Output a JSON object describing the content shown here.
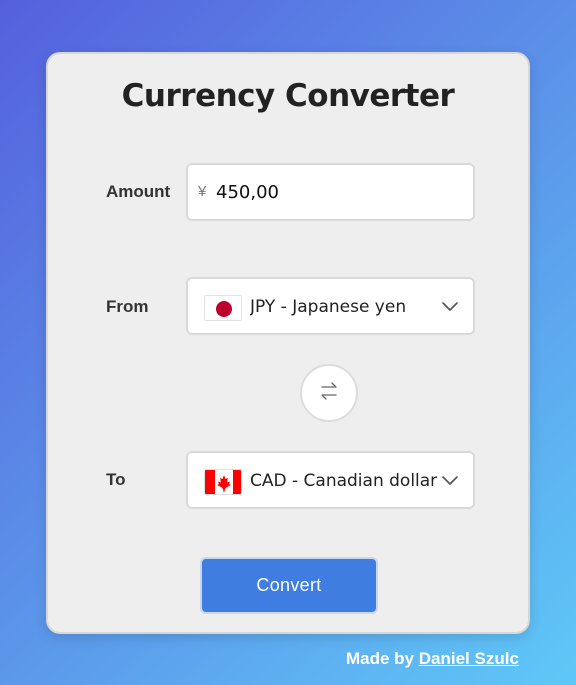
{
  "title": "Currency Converter",
  "amount": {
    "label": "Amount",
    "symbol": "¥",
    "value": "450,00"
  },
  "from": {
    "label": "From",
    "code": "JPY",
    "name": "Japanese yen",
    "display": "JPY - Japanese yen",
    "flag_icon": "japan-flag-icon"
  },
  "swap": {
    "icon": "swap-arrows-icon"
  },
  "to": {
    "label": "To",
    "code": "CAD",
    "name": "Canadian dollar",
    "display": "CAD - Canadian dollar",
    "flag_icon": "canada-flag-icon"
  },
  "convert_label": "Convert",
  "footer": {
    "prefix": "Made by",
    "author": "Daniel Szulc"
  },
  "colors": {
    "accent": "#3f7de0",
    "card_background": "#eeeeee",
    "japan_red": "#bc002d",
    "canada_red": "#ff0000"
  }
}
